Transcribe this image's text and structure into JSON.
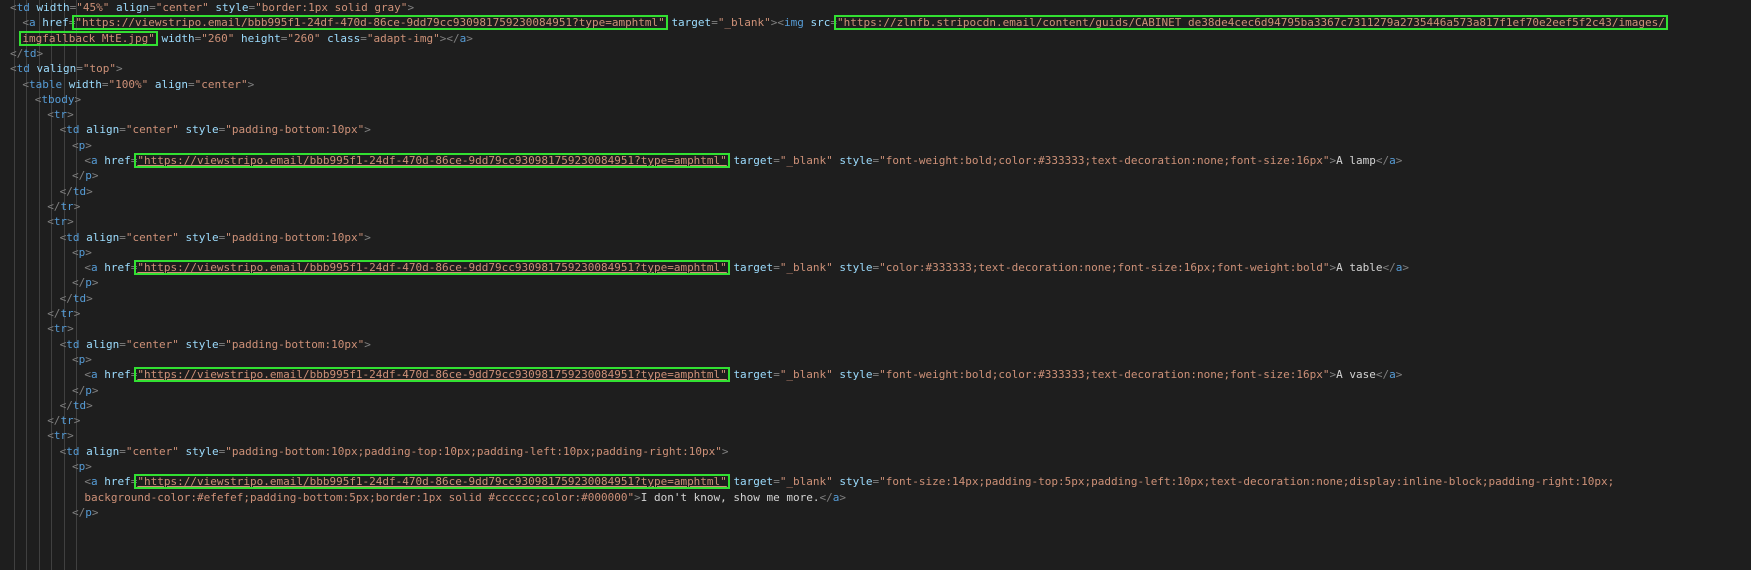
{
  "lines": [
    {
      "indent": 0,
      "tokens": [
        [
          "t",
          "<"
        ],
        [
          "n",
          "td"
        ],
        [
          "x",
          " "
        ],
        [
          "a",
          "width"
        ],
        [
          "t",
          "="
        ],
        [
          "s",
          "\"45%\""
        ],
        [
          "x",
          " "
        ],
        [
          "a",
          "align"
        ],
        [
          "t",
          "="
        ],
        [
          "s",
          "\"center\""
        ],
        [
          "x",
          " "
        ],
        [
          "a",
          "style"
        ],
        [
          "t",
          "="
        ],
        [
          "s",
          "\"border:1px solid gray\""
        ],
        [
          "t",
          ">"
        ]
      ]
    },
    {
      "indent": 1,
      "tokens": [
        [
          "t",
          "<"
        ],
        [
          "n",
          "a"
        ],
        [
          "x",
          " "
        ],
        [
          "a",
          "href"
        ],
        [
          "t",
          "="
        ],
        [
          "s",
          "\"https://viewstripo.email/bbb995f1-24df-470d-86ce-9dd79cc930981759230084951?type=amphtml\""
        ],
        [
          "x",
          " "
        ],
        [
          "a",
          "target"
        ],
        [
          "t",
          "="
        ],
        [
          "s",
          "\"_blank\""
        ],
        [
          "t",
          "><"
        ],
        [
          "n",
          "img"
        ],
        [
          "x",
          " "
        ],
        [
          "a",
          "src"
        ],
        [
          "t",
          "="
        ],
        [
          "s",
          "\"https://zlnfb.stripocdn.email/content/guids/CABINET_de38de4cec6d94795ba3367c7311279a2735446a573a817f1ef70e2eef5f2c43/images/"
        ]
      ]
    },
    {
      "indent": 1,
      "tokens": [
        [
          "s",
          "imgfallback_MtE.jpg\""
        ],
        [
          "x",
          " "
        ],
        [
          "a",
          "width"
        ],
        [
          "t",
          "="
        ],
        [
          "s",
          "\"260\""
        ],
        [
          "x",
          " "
        ],
        [
          "a",
          "height"
        ],
        [
          "t",
          "="
        ],
        [
          "s",
          "\"260\""
        ],
        [
          "x",
          " "
        ],
        [
          "a",
          "class"
        ],
        [
          "t",
          "="
        ],
        [
          "s",
          "\"adapt-img\""
        ],
        [
          "t",
          "></"
        ],
        [
          "n",
          "a"
        ],
        [
          "t",
          ">"
        ]
      ]
    },
    {
      "indent": 0,
      "tokens": [
        [
          "t",
          "</"
        ],
        [
          "n",
          "td"
        ],
        [
          "t",
          ">"
        ]
      ]
    },
    {
      "indent": 0,
      "tokens": [
        [
          "t",
          "<"
        ],
        [
          "n",
          "td"
        ],
        [
          "x",
          " "
        ],
        [
          "a",
          "valign"
        ],
        [
          "t",
          "="
        ],
        [
          "s",
          "\"top\""
        ],
        [
          "t",
          ">"
        ]
      ]
    },
    {
      "indent": 1,
      "tokens": [
        [
          "t",
          "<"
        ],
        [
          "n",
          "table"
        ],
        [
          "x",
          " "
        ],
        [
          "a",
          "width"
        ],
        [
          "t",
          "="
        ],
        [
          "s",
          "\"100%\""
        ],
        [
          "x",
          " "
        ],
        [
          "a",
          "align"
        ],
        [
          "t",
          "="
        ],
        [
          "s",
          "\"center\""
        ],
        [
          "t",
          ">"
        ]
      ]
    },
    {
      "indent": 2,
      "tokens": [
        [
          "t",
          "<"
        ],
        [
          "n",
          "tbody"
        ],
        [
          "t",
          ">"
        ]
      ]
    },
    {
      "indent": 3,
      "tokens": [
        [
          "t",
          "<"
        ],
        [
          "n",
          "tr"
        ],
        [
          "t",
          ">"
        ]
      ]
    },
    {
      "indent": 4,
      "tokens": [
        [
          "t",
          "<"
        ],
        [
          "n",
          "td"
        ],
        [
          "x",
          " "
        ],
        [
          "a",
          "align"
        ],
        [
          "t",
          "="
        ],
        [
          "s",
          "\"center\""
        ],
        [
          "x",
          " "
        ],
        [
          "a",
          "style"
        ],
        [
          "t",
          "="
        ],
        [
          "s",
          "\"padding-bottom:10px\""
        ],
        [
          "t",
          ">"
        ]
      ]
    },
    {
      "indent": 5,
      "tokens": [
        [
          "t",
          "<"
        ],
        [
          "n",
          "p"
        ],
        [
          "t",
          ">"
        ]
      ]
    },
    {
      "indent": 6,
      "tokens": [
        [
          "t",
          "<"
        ],
        [
          "n",
          "a"
        ],
        [
          "x",
          " "
        ],
        [
          "a",
          "href"
        ],
        [
          "t",
          "="
        ],
        [
          "s",
          "\"https://viewstripo.email/bbb995f1-24df-470d-86ce-9dd79cc930981759230084951?type=amphtml\""
        ],
        [
          "x",
          " "
        ],
        [
          "a",
          "target"
        ],
        [
          "t",
          "="
        ],
        [
          "s",
          "\"_blank\""
        ],
        [
          "x",
          " "
        ],
        [
          "a",
          "style"
        ],
        [
          "t",
          "="
        ],
        [
          "s",
          "\"font-weight:bold;color:#333333;text-decoration:none;font-size:16px\""
        ],
        [
          "t",
          ">"
        ],
        [
          "x",
          "A lamp"
        ],
        [
          "t",
          "</"
        ],
        [
          "n",
          "a"
        ],
        [
          "t",
          ">"
        ]
      ]
    },
    {
      "indent": 5,
      "tokens": [
        [
          "t",
          "</"
        ],
        [
          "n",
          "p"
        ],
        [
          "t",
          ">"
        ]
      ]
    },
    {
      "indent": 4,
      "tokens": [
        [
          "t",
          "</"
        ],
        [
          "n",
          "td"
        ],
        [
          "t",
          ">"
        ]
      ]
    },
    {
      "indent": 3,
      "tokens": [
        [
          "t",
          "</"
        ],
        [
          "n",
          "tr"
        ],
        [
          "t",
          ">"
        ]
      ]
    },
    {
      "indent": 3,
      "tokens": [
        [
          "t",
          "<"
        ],
        [
          "n",
          "tr"
        ],
        [
          "t",
          ">"
        ]
      ]
    },
    {
      "indent": 4,
      "tokens": [
        [
          "t",
          "<"
        ],
        [
          "n",
          "td"
        ],
        [
          "x",
          " "
        ],
        [
          "a",
          "align"
        ],
        [
          "t",
          "="
        ],
        [
          "s",
          "\"center\""
        ],
        [
          "x",
          " "
        ],
        [
          "a",
          "style"
        ],
        [
          "t",
          "="
        ],
        [
          "s",
          "\"padding-bottom:10px\""
        ],
        [
          "t",
          ">"
        ]
      ]
    },
    {
      "indent": 5,
      "tokens": [
        [
          "t",
          "<"
        ],
        [
          "n",
          "p"
        ],
        [
          "t",
          ">"
        ]
      ]
    },
    {
      "indent": 6,
      "tokens": [
        [
          "t",
          "<"
        ],
        [
          "n",
          "a"
        ],
        [
          "x",
          " "
        ],
        [
          "a",
          "href"
        ],
        [
          "t",
          "="
        ],
        [
          "s",
          "\"https://viewstripo.email/bbb995f1-24df-470d-86ce-9dd79cc930981759230084951?type=amphtml\""
        ],
        [
          "x",
          " "
        ],
        [
          "a",
          "target"
        ],
        [
          "t",
          "="
        ],
        [
          "s",
          "\"_blank\""
        ],
        [
          "x",
          " "
        ],
        [
          "a",
          "style"
        ],
        [
          "t",
          "="
        ],
        [
          "s",
          "\"color:#333333;text-decoration:none;font-size:16px;font-weight:bold\""
        ],
        [
          "t",
          ">"
        ],
        [
          "x",
          "A table"
        ],
        [
          "t",
          "</"
        ],
        [
          "n",
          "a"
        ],
        [
          "t",
          ">"
        ]
      ]
    },
    {
      "indent": 5,
      "tokens": [
        [
          "t",
          "</"
        ],
        [
          "n",
          "p"
        ],
        [
          "t",
          ">"
        ]
      ]
    },
    {
      "indent": 4,
      "tokens": [
        [
          "t",
          "</"
        ],
        [
          "n",
          "td"
        ],
        [
          "t",
          ">"
        ]
      ]
    },
    {
      "indent": 3,
      "tokens": [
        [
          "t",
          "</"
        ],
        [
          "n",
          "tr"
        ],
        [
          "t",
          ">"
        ]
      ]
    },
    {
      "indent": 3,
      "tokens": [
        [
          "t",
          "<"
        ],
        [
          "n",
          "tr"
        ],
        [
          "t",
          ">"
        ]
      ]
    },
    {
      "indent": 4,
      "tokens": [
        [
          "t",
          "<"
        ],
        [
          "n",
          "td"
        ],
        [
          "x",
          " "
        ],
        [
          "a",
          "align"
        ],
        [
          "t",
          "="
        ],
        [
          "s",
          "\"center\""
        ],
        [
          "x",
          " "
        ],
        [
          "a",
          "style"
        ],
        [
          "t",
          "="
        ],
        [
          "s",
          "\"padding-bottom:10px\""
        ],
        [
          "t",
          ">"
        ]
      ]
    },
    {
      "indent": 5,
      "tokens": [
        [
          "t",
          "<"
        ],
        [
          "n",
          "p"
        ],
        [
          "t",
          ">"
        ]
      ]
    },
    {
      "indent": 6,
      "tokens": [
        [
          "t",
          "<"
        ],
        [
          "n",
          "a"
        ],
        [
          "x",
          " "
        ],
        [
          "a",
          "href"
        ],
        [
          "t",
          "="
        ],
        [
          "s",
          "\"https://viewstripo.email/bbb995f1-24df-470d-86ce-9dd79cc930981759230084951?type=amphtml\""
        ],
        [
          "x",
          " "
        ],
        [
          "a",
          "target"
        ],
        [
          "t",
          "="
        ],
        [
          "s",
          "\"_blank\""
        ],
        [
          "x",
          " "
        ],
        [
          "a",
          "style"
        ],
        [
          "t",
          "="
        ],
        [
          "s",
          "\"font-weight:bold;color:#333333;text-decoration:none;font-size:16px\""
        ],
        [
          "t",
          ">"
        ],
        [
          "x",
          "A vase"
        ],
        [
          "t",
          "</"
        ],
        [
          "n",
          "a"
        ],
        [
          "t",
          ">"
        ]
      ]
    },
    {
      "indent": 5,
      "tokens": [
        [
          "t",
          "</"
        ],
        [
          "n",
          "p"
        ],
        [
          "t",
          ">"
        ]
      ]
    },
    {
      "indent": 4,
      "tokens": [
        [
          "t",
          "</"
        ],
        [
          "n",
          "td"
        ],
        [
          "t",
          ">"
        ]
      ]
    },
    {
      "indent": 3,
      "tokens": [
        [
          "t",
          "</"
        ],
        [
          "n",
          "tr"
        ],
        [
          "t",
          ">"
        ]
      ]
    },
    {
      "indent": 3,
      "tokens": [
        [
          "t",
          "<"
        ],
        [
          "n",
          "tr"
        ],
        [
          "t",
          ">"
        ]
      ]
    },
    {
      "indent": 4,
      "tokens": [
        [
          "t",
          "<"
        ],
        [
          "n",
          "td"
        ],
        [
          "x",
          " "
        ],
        [
          "a",
          "align"
        ],
        [
          "t",
          "="
        ],
        [
          "s",
          "\"center\""
        ],
        [
          "x",
          " "
        ],
        [
          "a",
          "style"
        ],
        [
          "t",
          "="
        ],
        [
          "s",
          "\"padding-bottom:10px;padding-top:10px;padding-left:10px;padding-right:10px\""
        ],
        [
          "t",
          ">"
        ]
      ]
    },
    {
      "indent": 5,
      "tokens": [
        [
          "t",
          "<"
        ],
        [
          "n",
          "p"
        ],
        [
          "t",
          ">"
        ]
      ]
    },
    {
      "indent": 6,
      "tokens": [
        [
          "t",
          "<"
        ],
        [
          "n",
          "a"
        ],
        [
          "x",
          " "
        ],
        [
          "a",
          "href"
        ],
        [
          "t",
          "="
        ],
        [
          "s",
          "\"https://viewstripo.email/bbb995f1-24df-470d-86ce-9dd79cc930981759230084951?type=amphtml\""
        ],
        [
          "x",
          " "
        ],
        [
          "a",
          "target"
        ],
        [
          "t",
          "="
        ],
        [
          "s",
          "\"_blank\""
        ],
        [
          "x",
          " "
        ],
        [
          "a",
          "style"
        ],
        [
          "t",
          "="
        ],
        [
          "s",
          "\"font-size:14px;padding-top:5px;padding-left:10px;text-decoration:none;display:inline-block;padding-right:10px;"
        ]
      ]
    },
    {
      "indent": 6,
      "tokens": [
        [
          "s",
          "background-color:#efefef;padding-bottom:5px;border:1px solid #cccccc;color:#000000\""
        ],
        [
          "t",
          ">"
        ],
        [
          "x",
          "I don't know, show me more."
        ],
        [
          "t",
          "</"
        ],
        [
          "n",
          "a"
        ],
        [
          "t",
          ">"
        ]
      ]
    },
    {
      "indent": 5,
      "tokens": [
        [
          "t",
          "</"
        ],
        [
          "n",
          "p"
        ],
        [
          "t",
          ">"
        ]
      ]
    }
  ],
  "colors": {
    "background": "#1e1e1e",
    "highlight_box": "#32e032",
    "tag": "#569cd6",
    "attribute": "#9cdcfe",
    "string": "#ce9178"
  }
}
